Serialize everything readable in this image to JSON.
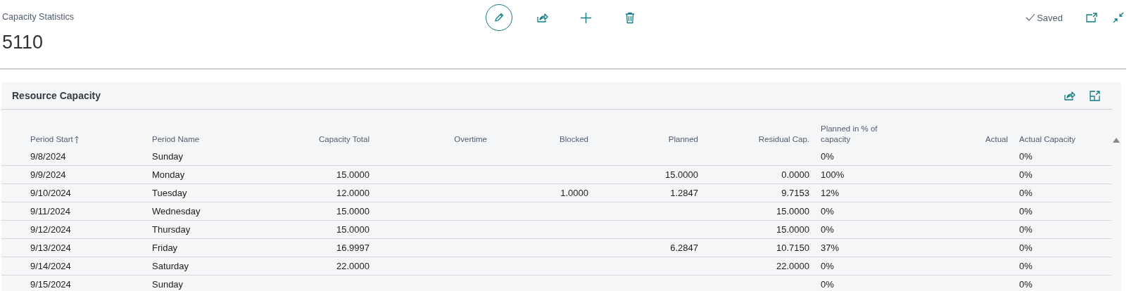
{
  "page": {
    "caption": "Capacity Statistics",
    "record": "5110",
    "status": "Saved"
  },
  "toolbar": [
    {
      "kind": "edit"
    },
    {
      "kind": "share"
    },
    {
      "kind": "new"
    },
    {
      "kind": "delete"
    }
  ],
  "window_actions": [
    {
      "kind": "open-new-window"
    },
    {
      "kind": "collapse"
    }
  ],
  "panel": {
    "title": "Resource Capacity",
    "actions": [
      {
        "kind": "share"
      },
      {
        "kind": "expand"
      }
    ],
    "table": {
      "columns": [
        {
          "label": "Period Start",
          "kind": "text",
          "sorted": true
        },
        {
          "label": "Period Name",
          "kind": "text",
          "sorted": false
        },
        {
          "label": "Capacity Total",
          "kind": "number",
          "sorted": false
        },
        {
          "label": "Overtime",
          "kind": "number",
          "sorted": false
        },
        {
          "label": "Blocked",
          "kind": "number",
          "sorted": false
        },
        {
          "label": "Planned",
          "kind": "number",
          "sorted": false
        },
        {
          "label": "Residual Cap.",
          "kind": "number",
          "sorted": false
        },
        {
          "label": "Planned in % of capacity",
          "kind": "text",
          "sorted": false
        },
        {
          "label": "Actual",
          "kind": "number",
          "sorted": false
        },
        {
          "label": "Actual Capacity",
          "kind": "text",
          "sorted": false
        }
      ],
      "rows": [
        [
          "9/8/2024",
          "Sunday",
          null,
          null,
          null,
          null,
          null,
          "0%",
          null,
          "0%"
        ],
        [
          "9/9/2024",
          "Monday",
          "15.0000",
          null,
          null,
          "15.0000",
          "0.0000",
          "100%",
          null,
          "0%"
        ],
        [
          "9/10/2024",
          "Tuesday",
          "12.0000",
          null,
          "1.0000",
          "1.2847",
          "9.7153",
          "12%",
          null,
          "0%"
        ],
        [
          "9/11/2024",
          "Wednesday",
          "15.0000",
          null,
          null,
          null,
          "15.0000",
          "0%",
          null,
          "0%"
        ],
        [
          "9/12/2024",
          "Thursday",
          "15.0000",
          null,
          null,
          null,
          "15.0000",
          "0%",
          null,
          "0%"
        ],
        [
          "9/13/2024",
          "Friday",
          "16.9997",
          null,
          null,
          "6.2847",
          "10.7150",
          "37%",
          null,
          "0%"
        ],
        [
          "9/14/2024",
          "Saturday",
          "22.0000",
          null,
          null,
          null,
          "22.0000",
          "0%",
          null,
          "0%"
        ],
        [
          "9/15/2024",
          "Sunday",
          null,
          null,
          null,
          null,
          null,
          "0%",
          null,
          "0%"
        ]
      ]
    }
  }
}
